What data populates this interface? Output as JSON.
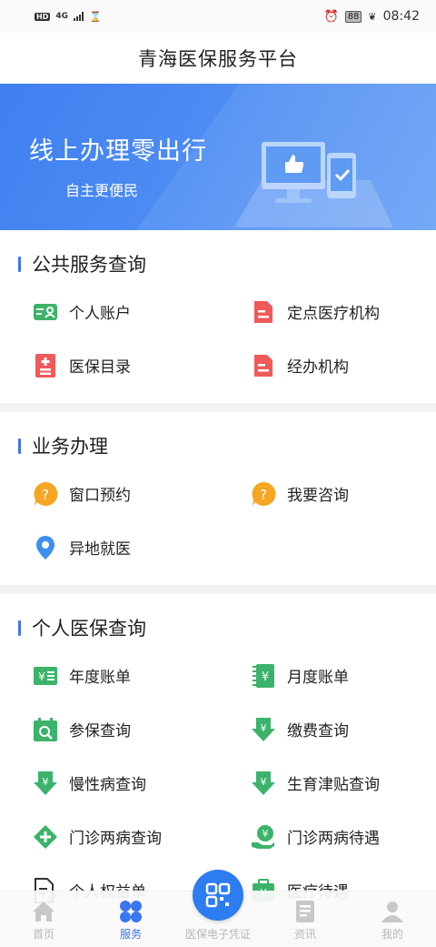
{
  "status_bar": {
    "left_hd": "HD",
    "left_net": "4G",
    "battery": "88",
    "time": "08:42"
  },
  "header": {
    "title": "青海医保服务平台"
  },
  "banner": {
    "title": "线上办理零出行",
    "subtitle": "自主更便民"
  },
  "sections": [
    {
      "title": "公共服务查询",
      "items": [
        {
          "label": "个人账户",
          "icon": "account-card-icon"
        },
        {
          "label": "定点医疗机构",
          "icon": "hospital-doc-icon"
        },
        {
          "label": "医保目录",
          "icon": "catalog-icon"
        },
        {
          "label": "经办机构",
          "icon": "agency-doc-icon"
        }
      ]
    },
    {
      "title": "业务办理",
      "items": [
        {
          "label": "窗口预约",
          "icon": "question-bubble-icon"
        },
        {
          "label": "我要咨询",
          "icon": "question-bubble-icon"
        },
        {
          "label": "异地就医",
          "icon": "location-pin-icon"
        }
      ]
    },
    {
      "title": "个人医保查询",
      "items": [
        {
          "label": "年度账单",
          "icon": "yearly-bill-icon"
        },
        {
          "label": "月度账单",
          "icon": "monthly-bill-icon"
        },
        {
          "label": "参保查询",
          "icon": "insurance-search-icon"
        },
        {
          "label": "缴费查询",
          "icon": "payment-search-icon"
        },
        {
          "label": "慢性病查询",
          "icon": "chronic-search-icon"
        },
        {
          "label": "生育津贴查询",
          "icon": "maternity-search-icon"
        },
        {
          "label": "门诊两病查询",
          "icon": "outpatient-search-icon"
        },
        {
          "label": "门诊两病待遇",
          "icon": "outpatient-benefit-icon"
        },
        {
          "label": "个人权益单",
          "icon": "rights-doc-icon"
        },
        {
          "label": "医疗待遇",
          "icon": "medical-benefit-icon"
        }
      ]
    }
  ],
  "tabbar": [
    {
      "label": "首页"
    },
    {
      "label": "服务"
    },
    {
      "label": "医保电子凭证"
    },
    {
      "label": "资讯"
    },
    {
      "label": "我的"
    }
  ],
  "colors": {
    "accent": "#3a76ee",
    "green": "#3bb36a",
    "red": "#f05a5a",
    "orange": "#f5a623",
    "blue_pin": "#3a8ff0"
  }
}
